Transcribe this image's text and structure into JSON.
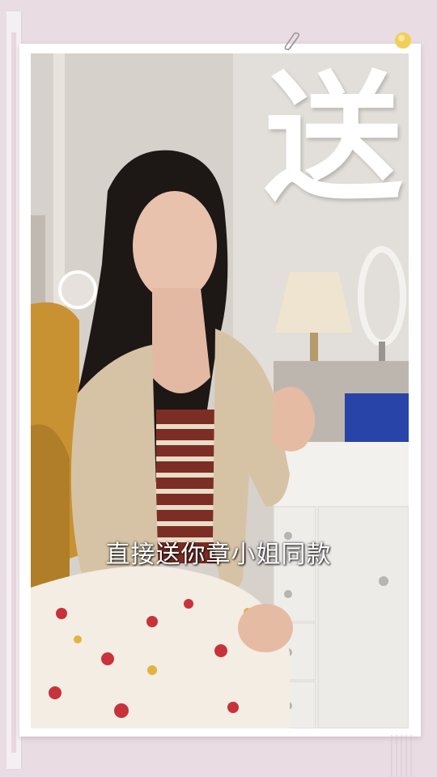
{
  "overlay": {
    "big_character": "送",
    "subtitle": "直接送你章小姐同款"
  },
  "colors": {
    "background": "#e9dde3",
    "card": "#ffffff",
    "text": "#ffffff",
    "pin": "#f2cf5a"
  },
  "icons": {
    "paperclip": "paperclip-icon",
    "pushpin": "pushpin-icon"
  }
}
